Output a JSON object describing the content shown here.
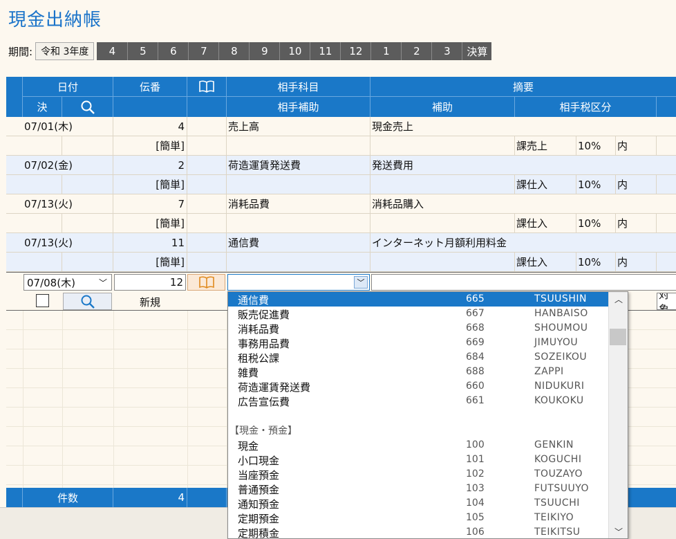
{
  "app": {
    "title": "現金出納帳"
  },
  "period": {
    "label": "期間:",
    "year": "令和 3年度",
    "months": [
      "4",
      "5",
      "6",
      "7",
      "8",
      "9",
      "10",
      "11",
      "12",
      "1",
      "2",
      "3"
    ],
    "settlement": "決算"
  },
  "header": {
    "date": "日付",
    "voucher_no": "伝番",
    "account": "相手科目",
    "summary": "摘要",
    "settle": "決",
    "sub_account": "相手補助",
    "sub": "補助",
    "tax_class": "相手税区分"
  },
  "rows": [
    {
      "date": "07/01(木)",
      "no": "4",
      "account": "売上高",
      "summary": "現金売上",
      "mode": "[簡単]",
      "tax": "課売上",
      "rate": "10%",
      "incl": "内"
    },
    {
      "date": "07/02(金)",
      "no": "2",
      "account": "荷造運賃発送費",
      "summary": "発送費用",
      "mode": "[簡単]",
      "tax": "課仕入",
      "rate": "10%",
      "incl": "内"
    },
    {
      "date": "07/13(火)",
      "no": "7",
      "account": "消耗品費",
      "summary": "消耗品購入",
      "mode": "[簡単]",
      "tax": "課仕入",
      "rate": "10%",
      "incl": "内"
    },
    {
      "date": "07/13(火)",
      "no": "11",
      "account": "通信費",
      "summary": "インターネット月額利用料金",
      "mode": "[簡単]",
      "tax": "課仕入",
      "rate": "10%",
      "incl": "内"
    }
  ],
  "entry": {
    "date": "07/08(木)",
    "no": "12",
    "new_label": "新規",
    "right_label": "対象"
  },
  "dropdown": {
    "items": [
      {
        "name": "通信費",
        "code": "665",
        "kana": "TSUUSHIN"
      },
      {
        "name": "販売促進費",
        "code": "667",
        "kana": "HANBAISO"
      },
      {
        "name": "消耗品費",
        "code": "668",
        "kana": "SHOUMOU"
      },
      {
        "name": "事務用品費",
        "code": "669",
        "kana": "JIMUYOU"
      },
      {
        "name": "租税公課",
        "code": "684",
        "kana": "SOZEIKOU"
      },
      {
        "name": "雑費",
        "code": "688",
        "kana": "ZAPPI"
      },
      {
        "name": "荷造運賃発送費",
        "code": "660",
        "kana": "NIDUKURI"
      },
      {
        "name": "広告宣伝費",
        "code": "661",
        "kana": "KOUKOKU"
      }
    ],
    "group_label": "【現金・預金】",
    "group_items": [
      {
        "name": "現金",
        "code": "100",
        "kana": "GENKIN"
      },
      {
        "name": "小口現金",
        "code": "101",
        "kana": "KOGUCHI"
      },
      {
        "name": "当座預金",
        "code": "102",
        "kana": "TOUZAYO"
      },
      {
        "name": "普通預金",
        "code": "103",
        "kana": "FUTSUUYO"
      },
      {
        "name": "通知預金",
        "code": "104",
        "kana": "TSUUCHI"
      },
      {
        "name": "定期預金",
        "code": "105",
        "kana": "TEIKIYO"
      },
      {
        "name": "定期積金",
        "code": "106",
        "kana": "TEIKITSU"
      }
    ]
  },
  "footer": {
    "count_label": "件数",
    "count": "4"
  },
  "colors": {
    "header": "#1a78c8",
    "accent": "#2e8b3a",
    "dark_button": "#5c5c5c"
  }
}
